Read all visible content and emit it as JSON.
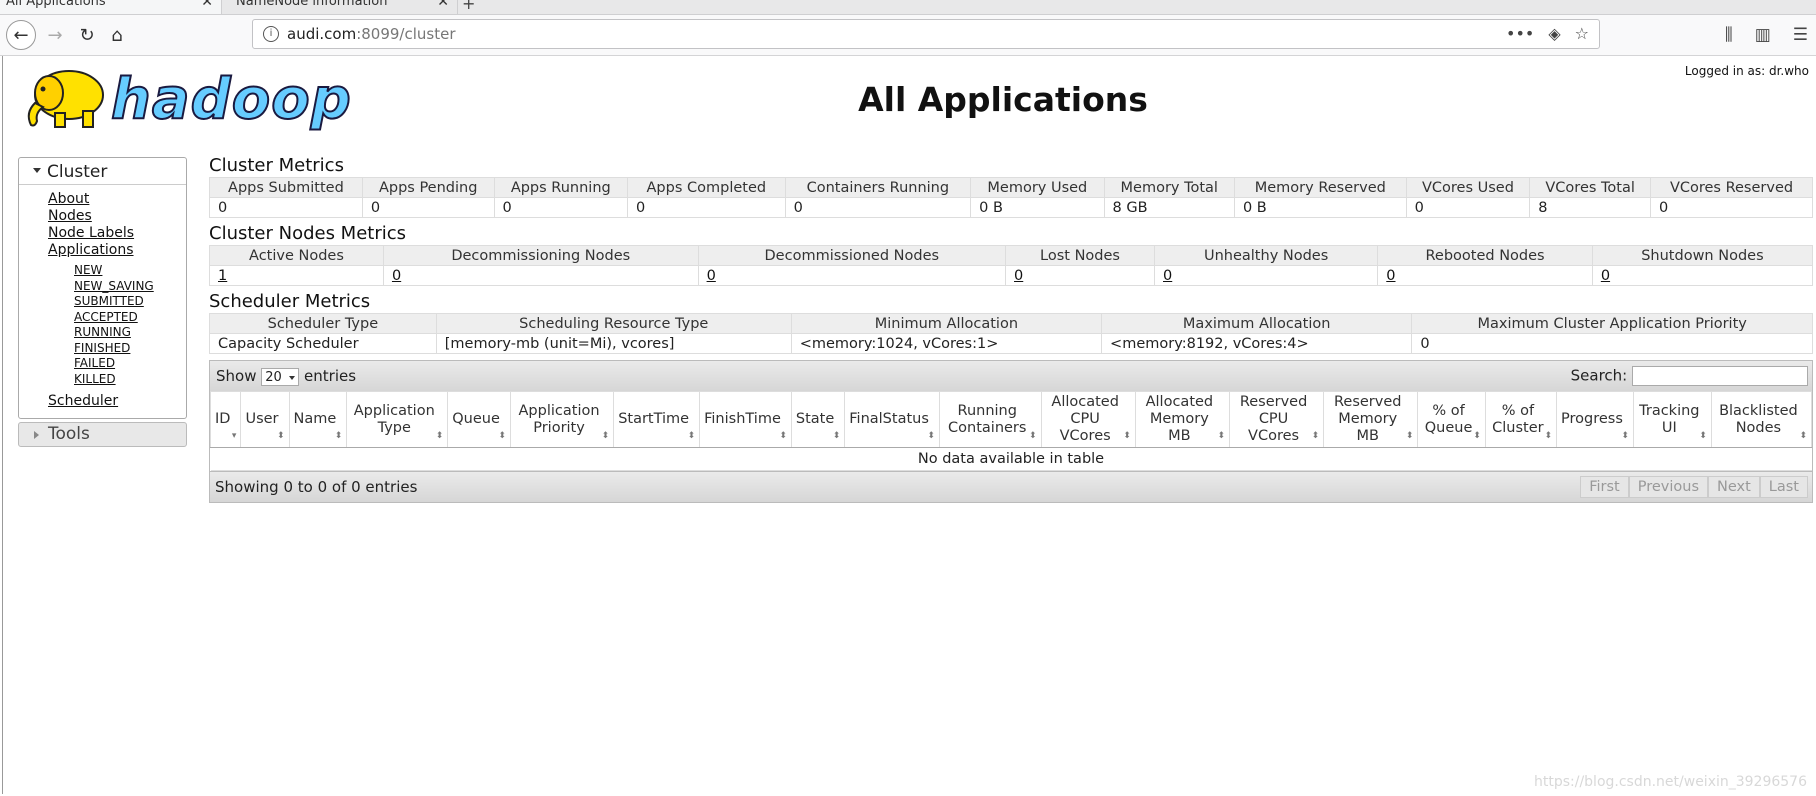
{
  "browser": {
    "tabs": [
      {
        "label": "All Applications",
        "active": true
      },
      {
        "label": "NameNode information",
        "active": false
      }
    ],
    "url_host": "audi.com",
    "url_rest": ":8099/cluster"
  },
  "header": {
    "logo_text": "hadoop",
    "title": "All Applications",
    "logged_in": "Logged in as: dr.who"
  },
  "sidebar": {
    "cluster_label": "Cluster",
    "items": [
      "About",
      "Nodes",
      "Node Labels",
      "Applications"
    ],
    "app_states": [
      "NEW",
      "NEW_SAVING",
      "SUBMITTED",
      "ACCEPTED",
      "RUNNING",
      "FINISHED",
      "FAILED",
      "KILLED"
    ],
    "scheduler_label": "Scheduler",
    "tools_label": "Tools"
  },
  "cluster_metrics": {
    "title": "Cluster Metrics",
    "headers": [
      "Apps Submitted",
      "Apps Pending",
      "Apps Running",
      "Apps Completed",
      "Containers Running",
      "Memory Used",
      "Memory Total",
      "Memory Reserved",
      "VCores Used",
      "VCores Total",
      "VCores Reserved"
    ],
    "values": [
      "0",
      "0",
      "0",
      "0",
      "0",
      "0 B",
      "8 GB",
      "0 B",
      "0",
      "8",
      "0"
    ]
  },
  "node_metrics": {
    "title": "Cluster Nodes Metrics",
    "headers": [
      "Active Nodes",
      "Decommissioning Nodes",
      "Decommissioned Nodes",
      "Lost Nodes",
      "Unhealthy Nodes",
      "Rebooted Nodes",
      "Shutdown Nodes"
    ],
    "values": [
      "1",
      "0",
      "0",
      "0",
      "0",
      "0",
      "0"
    ]
  },
  "scheduler_metrics": {
    "title": "Scheduler Metrics",
    "headers": [
      "Scheduler Type",
      "Scheduling Resource Type",
      "Minimum Allocation",
      "Maximum Allocation",
      "Maximum Cluster Application Priority"
    ],
    "values": [
      "Capacity Scheduler",
      "[memory-mb (unit=Mi), vcores]",
      "<memory:1024, vCores:1>",
      "<memory:8192, vCores:4>",
      "0"
    ]
  },
  "apps_table": {
    "show_label": "Show",
    "entries_value": "20",
    "entries_label": "entries",
    "search_label": "Search:",
    "columns": [
      "ID",
      "User",
      "Name",
      "Application Type",
      "Queue",
      "Application Priority",
      "StartTime",
      "FinishTime",
      "State",
      "FinalStatus",
      "Running Containers",
      "Allocated CPU VCores",
      "Allocated Memory MB",
      "Reserved CPU VCores",
      "Reserved Memory MB",
      "% of Queue",
      "% of Cluster",
      "Progress",
      "Tracking UI",
      "Blacklisted Nodes"
    ],
    "empty_message": "No data available in table",
    "info": "Showing 0 to 0 of 0 entries",
    "pager": [
      "First",
      "Previous",
      "Next",
      "Last"
    ]
  },
  "watermark": "https://blog.csdn.net/weixin_39296576"
}
